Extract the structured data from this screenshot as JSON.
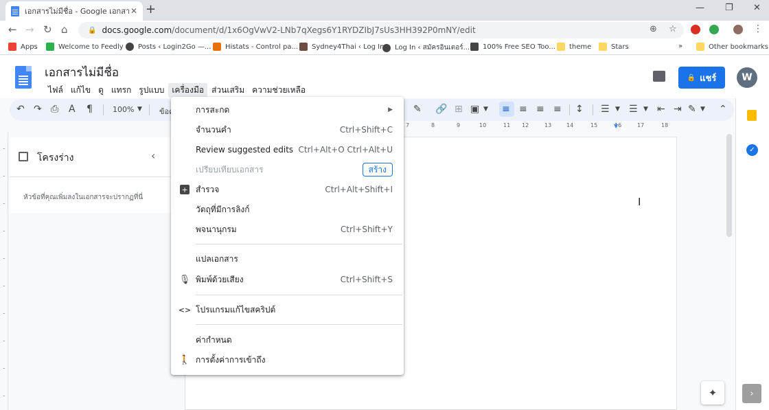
{
  "browser": {
    "tab_title": "เอกสารไม่มีชื่อ - Google เอกสาร",
    "url_host": "docs.google.com",
    "url_path": "/document/d/1x6OgVwV2-LNb7qXegs6Y1RYDZIbJ7sUs3HH392P0mNY/edit"
  },
  "bookmarks": [
    {
      "label": "Apps",
      "color": "#ea4335"
    },
    {
      "label": "Welcome to Feedly",
      "color": "#2bb24c"
    },
    {
      "label": "Posts ‹ Login2Go —...",
      "color": "#444444"
    },
    {
      "label": "Histats - Control pa...",
      "color": "#e8710a"
    },
    {
      "label": "Sydney4Thai ‹ Log In",
      "color": "#6d4c41"
    },
    {
      "label": "Log In ‹ สมัครอินเตอร์...",
      "color": "#444444"
    },
    {
      "label": "100% Free SEO Too...",
      "color": "#444444"
    },
    {
      "label": "theme",
      "color": "#fdd663"
    },
    {
      "label": "Stars",
      "color": "#fdd663"
    },
    {
      "label": "Other bookmarks",
      "color": "#fdd663"
    }
  ],
  "docs": {
    "title": "เอกสารไม่มีชื่อ",
    "menus": [
      "ไฟล์",
      "แก้ไข",
      "ดู",
      "แทรก",
      "รูปแบบ",
      "เครื่องมือ",
      "ส่วนเสริม",
      "ความช่วยเหลือ"
    ],
    "share_label": "แชร์",
    "avatar_letter": "W",
    "zoom": "100%",
    "style_label": "ข้อค"
  },
  "outline": {
    "title": "โครงร่าง",
    "hint": "หัวข้อที่คุณเพิ่มลงในเอกสารจะปรากฏที่นี่"
  },
  "ruler_marks": [
    "7",
    "8",
    "9",
    "10",
    "11",
    "12",
    "13",
    "14",
    "15",
    "16",
    "17",
    "18"
  ],
  "tools_menu": {
    "items": [
      {
        "label": "การสะกด",
        "shortcut": "",
        "submenu": true
      },
      {
        "label": "จำนวนคำ",
        "shortcut": "Ctrl+Shift+C"
      },
      {
        "label": "Review suggested edits",
        "shortcut": "Ctrl+Alt+O Ctrl+Alt+U"
      },
      {
        "label": "เปรียบเทียบเอกสาร",
        "shortcut": "",
        "badge": "สร้าง"
      },
      {
        "label": "สำรวจ",
        "shortcut": "Ctrl+Alt+Shift+I",
        "icon": "explore-icon"
      },
      {
        "label": "วัตถุที่มีการลิงก์",
        "shortcut": ""
      },
      {
        "label": "พจนานุกรม",
        "shortcut": "Ctrl+Shift+Y"
      },
      {
        "label": "แปลเอกสาร",
        "shortcut": ""
      },
      {
        "label": "พิมพ์ด้วยเสียง",
        "shortcut": "Ctrl+Shift+S",
        "icon": "microphone-icon"
      },
      {
        "label": "โปรแกรมแก้ไขสคริปต์",
        "shortcut": "",
        "icon": "code-icon"
      },
      {
        "label": "ค่ากำหนด",
        "shortcut": ""
      },
      {
        "label": "การตั้งค่าการเข้าถึง",
        "shortcut": "",
        "icon": "accessibility-icon"
      }
    ]
  },
  "colors": {
    "accent": "#1a73e8",
    "toolbar_bg": "#edf2fa"
  }
}
